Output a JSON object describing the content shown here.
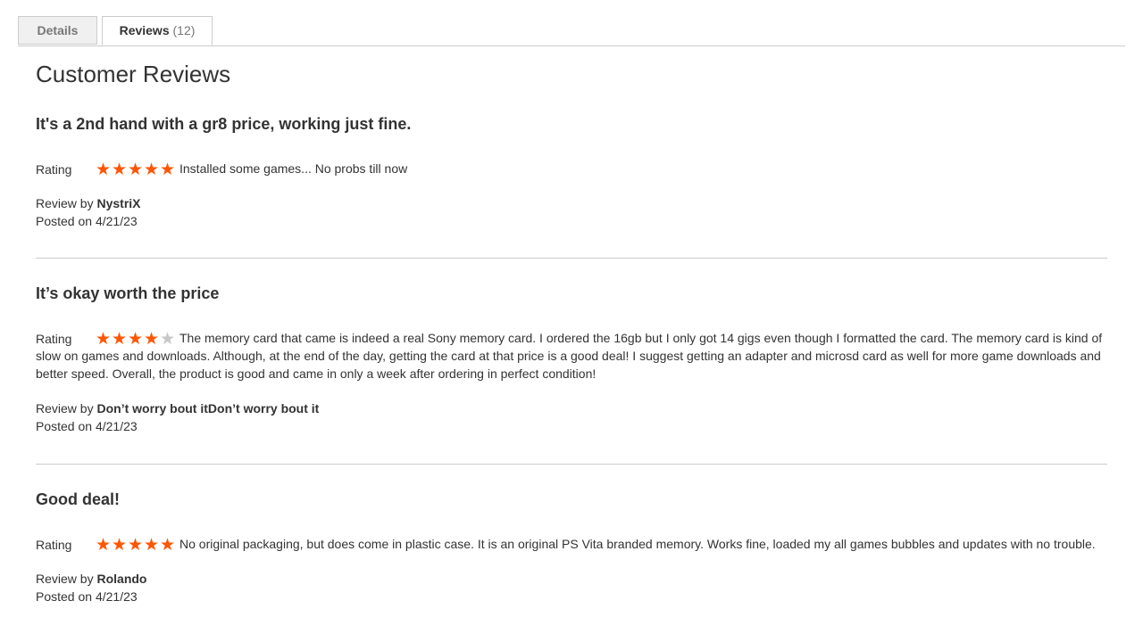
{
  "tabs": {
    "details_label": "Details",
    "reviews_label": "Reviews",
    "reviews_count": "(12)"
  },
  "section_title": "Customer Reviews",
  "rating_label": "Rating",
  "review_by_label": "Review by",
  "posted_on_label": "Posted on",
  "star_color": "#ff5501",
  "star_empty_color": "#c7c7c7",
  "reviews": [
    {
      "title": "It's a 2nd hand with a gr8 price, working just fine.",
      "rating": 5,
      "text": "Installed some games... No probs till now",
      "author": "NystriX",
      "date": "4/21/23"
    },
    {
      "title": "It’s okay worth the price",
      "rating": 4,
      "text": "The memory card that came is indeed a real Sony memory card. I ordered the 16gb but I only got 14 gigs even though I formatted the card. The memory card is kind of slow on games and downloads. Although, at the end of the day, getting the card at that price is a good deal! I suggest getting an adapter and microsd card as well for more game downloads and better speed. Overall, the product is good and came in only a week after ordering in perfect condition!",
      "author": "Don’t worry bout itDon’t worry bout it",
      "date": "4/21/23"
    },
    {
      "title": "Good deal!",
      "rating": 5,
      "text": "No original packaging, but does come in plastic case. It is an original PS Vita branded memory. Works fine, loaded my all games bubbles and updates with no trouble.",
      "author": "Rolando",
      "date": "4/21/23"
    }
  ]
}
